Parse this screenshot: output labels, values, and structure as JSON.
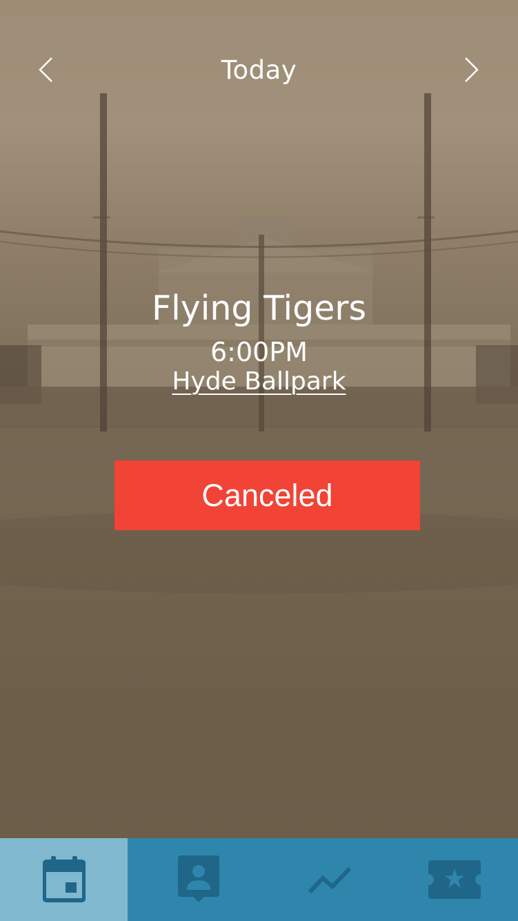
{
  "header": {
    "title": "Today",
    "prev_icon": "chevron-left-icon",
    "next_icon": "chevron-right-icon"
  },
  "game": {
    "team": "Flying Tigers",
    "time": "6:00PM",
    "venue": "Hyde Ballpark",
    "status": "Canceled"
  },
  "tabs": [
    {
      "icon": "calendar-icon",
      "active": true
    },
    {
      "icon": "profile-icon",
      "active": false
    },
    {
      "icon": "trend-chart-icon",
      "active": false
    },
    {
      "icon": "ticket-star-icon",
      "active": false
    }
  ],
  "colors": {
    "status_canceled": "#f14336",
    "tabbar": "#2e86ad",
    "tab_active": "#80b8d0",
    "tab_icon": "#1f6688"
  }
}
